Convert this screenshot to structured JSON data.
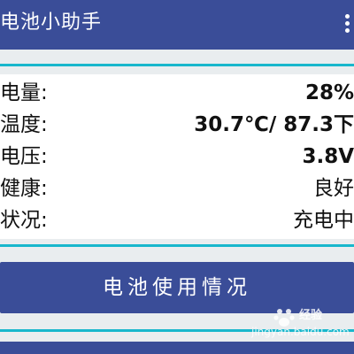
{
  "app": {
    "title": "电池小助手",
    "menu_icon": "more-vertical-icon"
  },
  "battery": {
    "rows": [
      {
        "label": "电量:",
        "value": "28%"
      },
      {
        "label": "温度:",
        "value": "30.7℃/ 87.3下"
      },
      {
        "label": "电压:",
        "value": "3.8V"
      },
      {
        "label": "健康:",
        "value": "良好"
      },
      {
        "label": "状况:",
        "value": "充电中"
      }
    ]
  },
  "actions": {
    "usage_label": "电池使用情况"
  },
  "watermark": {
    "brand": "经验",
    "site": "jingyan.baidu.com"
  },
  "colors": {
    "primary": "#3a4d98",
    "accent": "#18b7cc",
    "background": "#e9edef"
  }
}
